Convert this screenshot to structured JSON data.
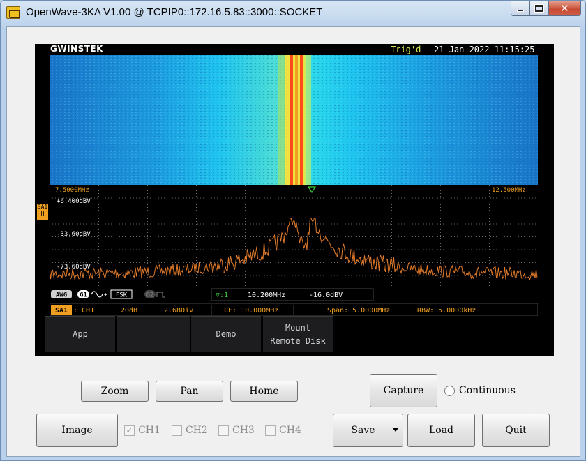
{
  "window": {
    "title": "OpenWave-3KA V1.00 @ TCPIP0::172.16.5.83::3000::SOCKET",
    "controls": {
      "minimize": "minimize",
      "maximize": "maximize",
      "close": "✕"
    }
  },
  "scope": {
    "brand": "GWINSTEK",
    "trigger_status": "Trig'd",
    "datetime": "21 Jan 2022 11:15:25",
    "spectrum": {
      "start_freq": "7.5000MHz",
      "stop_freq": "12.500MHz",
      "ref_level_1": "+6.400dBV",
      "ref_level_2": "-33.60dBV",
      "ref_level_3": "-73.60dBV",
      "side_tag": "SA1 H"
    },
    "info": {
      "awg": "AWG",
      "g1": "G1",
      "fsk": "FSK",
      "g2": "G2",
      "marker_label": "▽:1",
      "marker_freq": "10.200MHz",
      "marker_level": "-16.0dBV"
    },
    "status": {
      "source": "SA1",
      "channel": ": CH1",
      "atten": "20dB",
      "scale": "2.68Div",
      "cf": "CF: 10.000MHz",
      "span": "Span: 5.0000MHz",
      "rbw": "RBW: 5.0000kHz"
    },
    "softkeys": {
      "app": "App",
      "demo": "Demo",
      "mount_line1": "Mount",
      "mount_line2": "Remote Disk"
    },
    "colors": {
      "trace": "#e07a2a",
      "grid": "#555555",
      "label": "#f0a020",
      "waterfall_bg": "#1fb4e8",
      "peak": "#ff4a1a"
    }
  },
  "controls": {
    "zoom": "Zoom",
    "pan": "Pan",
    "home": "Home",
    "capture": "Capture",
    "continuous": "Continuous",
    "image": "Image",
    "ch1": "CH1",
    "ch2": "CH2",
    "ch3": "CH3",
    "ch4": "CH4",
    "save": "Save",
    "load": "Load",
    "quit": "Quit"
  }
}
